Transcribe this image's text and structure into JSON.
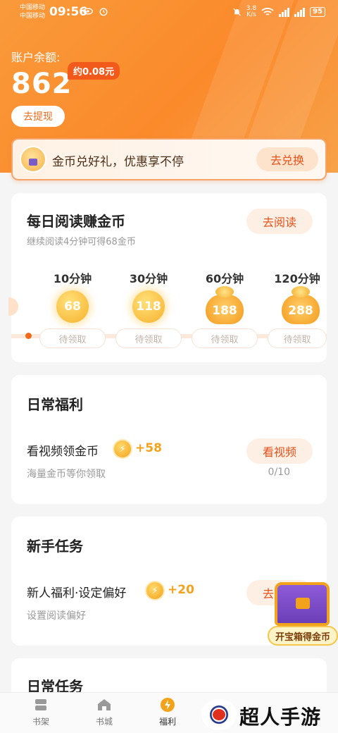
{
  "status_bar": {
    "carrier_1": "中国移动",
    "carrier_2": "中国移动",
    "time": "09:56",
    "net_speed_value": "3.8",
    "net_speed_unit": "K/s",
    "battery": "95"
  },
  "account": {
    "balance_label": "账户余额:",
    "balance_value": "862",
    "approx_label": "约0.08元",
    "withdraw_label": "去提现"
  },
  "exchange_banner": {
    "text": "金币兑好礼，优惠享不停",
    "button": "去兑换"
  },
  "daily_reading": {
    "title": "每日阅读赚金币",
    "button": "去阅读",
    "subtitle": "继续阅读4分钟可得68金币",
    "milestones": [
      {
        "time": "10分钟",
        "coins": "68",
        "status": "待领取",
        "icon": "coin-icon"
      },
      {
        "time": "30分钟",
        "coins": "118",
        "status": "待领取",
        "icon": "coin-icon"
      },
      {
        "time": "60分钟",
        "coins": "188",
        "status": "待领取",
        "icon": "coin-bag-icon"
      },
      {
        "time": "120分钟",
        "coins": "288",
        "status": "待领取",
        "icon": "coin-bag-icon"
      }
    ]
  },
  "daily_welfare": {
    "title": "日常福利",
    "tasks": [
      {
        "name": "看视频领金币",
        "reward": "+58",
        "desc": "海量金币等你领取",
        "button": "看视频",
        "progress": "0/10"
      }
    ]
  },
  "newbie_tasks": {
    "title": "新手任务",
    "tasks": [
      {
        "name": "新人福利·设定偏好",
        "reward": "+20",
        "desc": "设置阅读偏好",
        "button": "去完成"
      }
    ]
  },
  "daily_tasks": {
    "title": "日常任务"
  },
  "treasure": {
    "label": "开宝箱得金币"
  },
  "nav": {
    "items": [
      {
        "label": "书架",
        "icon": "bookshelf-icon"
      },
      {
        "label": "书城",
        "icon": "bookstore-icon"
      },
      {
        "label": "福利",
        "icon": "welfare-icon"
      }
    ]
  },
  "watermark": {
    "text": "超人手游网"
  },
  "colors": {
    "accent": "#f06a1a",
    "gold": "#f3a21c",
    "hero_orange": "#fb8a2b"
  }
}
